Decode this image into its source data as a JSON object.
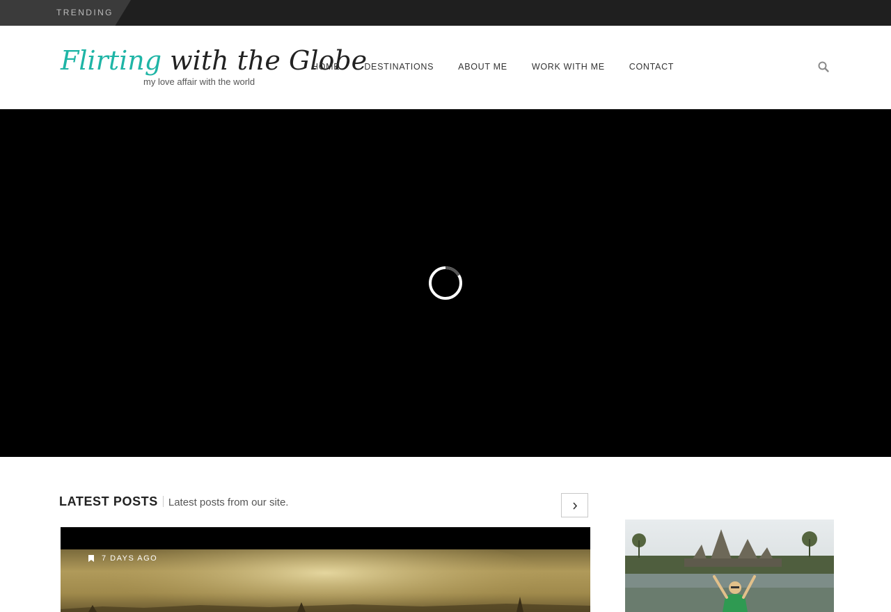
{
  "trending": {
    "label": "TRENDING"
  },
  "header": {
    "logo": {
      "script_accent": "Flirting",
      "script_rest": "with the Globe",
      "tagline": "my love affair with the world"
    },
    "nav": [
      {
        "label": "HOME"
      },
      {
        "label": "DESTINATIONS"
      },
      {
        "label": "ABOUT ME"
      },
      {
        "label": "WORK WITH ME"
      },
      {
        "label": "CONTACT"
      }
    ],
    "search_icon": "search-icon"
  },
  "hero": {
    "state": "loading",
    "icon": "loading-spinner-icon"
  },
  "latest_posts": {
    "title": "LATEST POSTS",
    "subtitle": "Latest posts from our site.",
    "next_icon": "chevron-right-icon",
    "posts": [
      {
        "date": "7 DAYS AGO",
        "icon": "bookmark-icon"
      }
    ]
  },
  "sidebar": {
    "photo_icon": "photo"
  },
  "colors": {
    "brand_accent": "#1fb5a6",
    "topbar": "#1f1f1f",
    "trending_tab": "#3b3b3b",
    "hero_bg": "#000000",
    "text_dark": "#222222"
  }
}
